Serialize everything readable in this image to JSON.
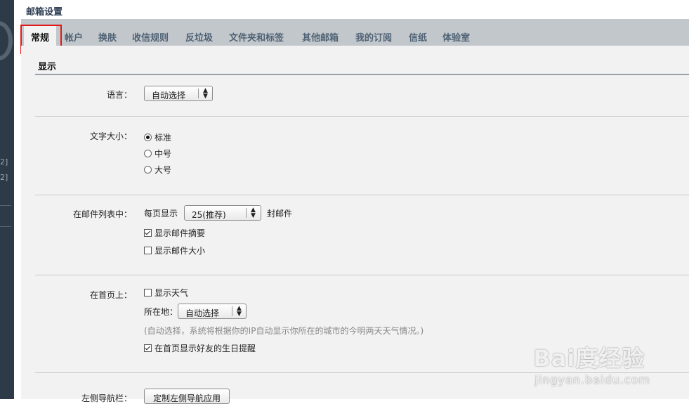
{
  "page_title": "邮箱设置",
  "sidebar": {
    "labels": [
      "2]",
      "2]"
    ]
  },
  "tabs": [
    {
      "label": "常规",
      "active": true
    },
    {
      "label": "帐户"
    },
    {
      "label": "换肤"
    },
    {
      "label": "收信规则"
    },
    {
      "label": "反垃圾"
    },
    {
      "label": "文件夹和标签"
    },
    {
      "label": "其他邮箱"
    },
    {
      "label": "我的订阅"
    },
    {
      "label": "信纸"
    },
    {
      "label": "体验室"
    }
  ],
  "section": {
    "title": "显示"
  },
  "language": {
    "label": "语言：",
    "value": "自动选择"
  },
  "font_size": {
    "label": "文字大小：",
    "options": [
      {
        "label": "标准",
        "checked": true
      },
      {
        "label": "中号",
        "checked": false
      },
      {
        "label": "大号",
        "checked": false
      }
    ]
  },
  "mail_list": {
    "label": "在邮件列表中：",
    "per_page_prefix": "每页显示",
    "per_page_value": "25(推荐)",
    "per_page_suffix": "封邮件",
    "show_summary": {
      "label": "显示邮件摘要",
      "checked": true
    },
    "show_size": {
      "label": "显示邮件大小",
      "checked": false
    }
  },
  "homepage": {
    "label": "在首页上：",
    "show_weather": {
      "label": "显示天气",
      "checked": false
    },
    "location_label": "所在地：",
    "location_value": "自动选择",
    "hint": "(自动选择，系统将根据你的IP自动显示你所在的城市的今明两天天气情况。)",
    "birthday": {
      "label": "在首页显示好友的生日提醒",
      "checked": true
    }
  },
  "left_nav": {
    "label": "左侧导航栏：",
    "button": "定制左侧导航应用"
  },
  "watermark": {
    "main": "Bai度经验",
    "sub": "jingyan.baidu.com"
  },
  "colors": {
    "highlight": "#e01a1a",
    "tabbar": "#c2c7cc",
    "panel": "#f2f2f2",
    "sidebar": "#2d3a47"
  }
}
